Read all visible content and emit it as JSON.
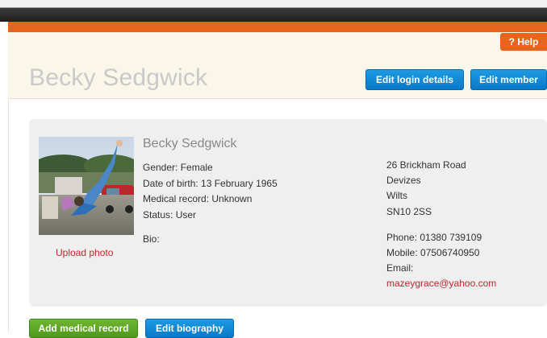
{
  "header": {
    "help_label": "? Help",
    "page_title": "Becky Sedgwick",
    "edit_login_label": "Edit login details",
    "edit_member_label": "Edit member"
  },
  "profile": {
    "name": "Becky Sedgwick",
    "gender": "Gender: Female",
    "dob": "Date of birth: 13 February 1965",
    "medical": "Medical record: Unknown",
    "status": "Status: User",
    "bio": "Bio:",
    "upload_photo": "Upload photo"
  },
  "address": {
    "line1": "26 Brickham Road",
    "line2": "Devizes",
    "line3": "Wilts",
    "postcode": "SN10 2SS"
  },
  "contact": {
    "phone": "Phone: 01380 739109",
    "mobile": "Mobile: 07506740950",
    "email_label": "Email:",
    "email": "mazeygrace@yahoo.com"
  },
  "actions": {
    "add_medical_label": "Add medical record",
    "edit_bio_label": "Edit biography"
  },
  "colors": {
    "accent_orange": "#e8641b",
    "button_blue": "#0a78c8",
    "button_green": "#4e9a1d",
    "link_red": "#c0282d"
  }
}
